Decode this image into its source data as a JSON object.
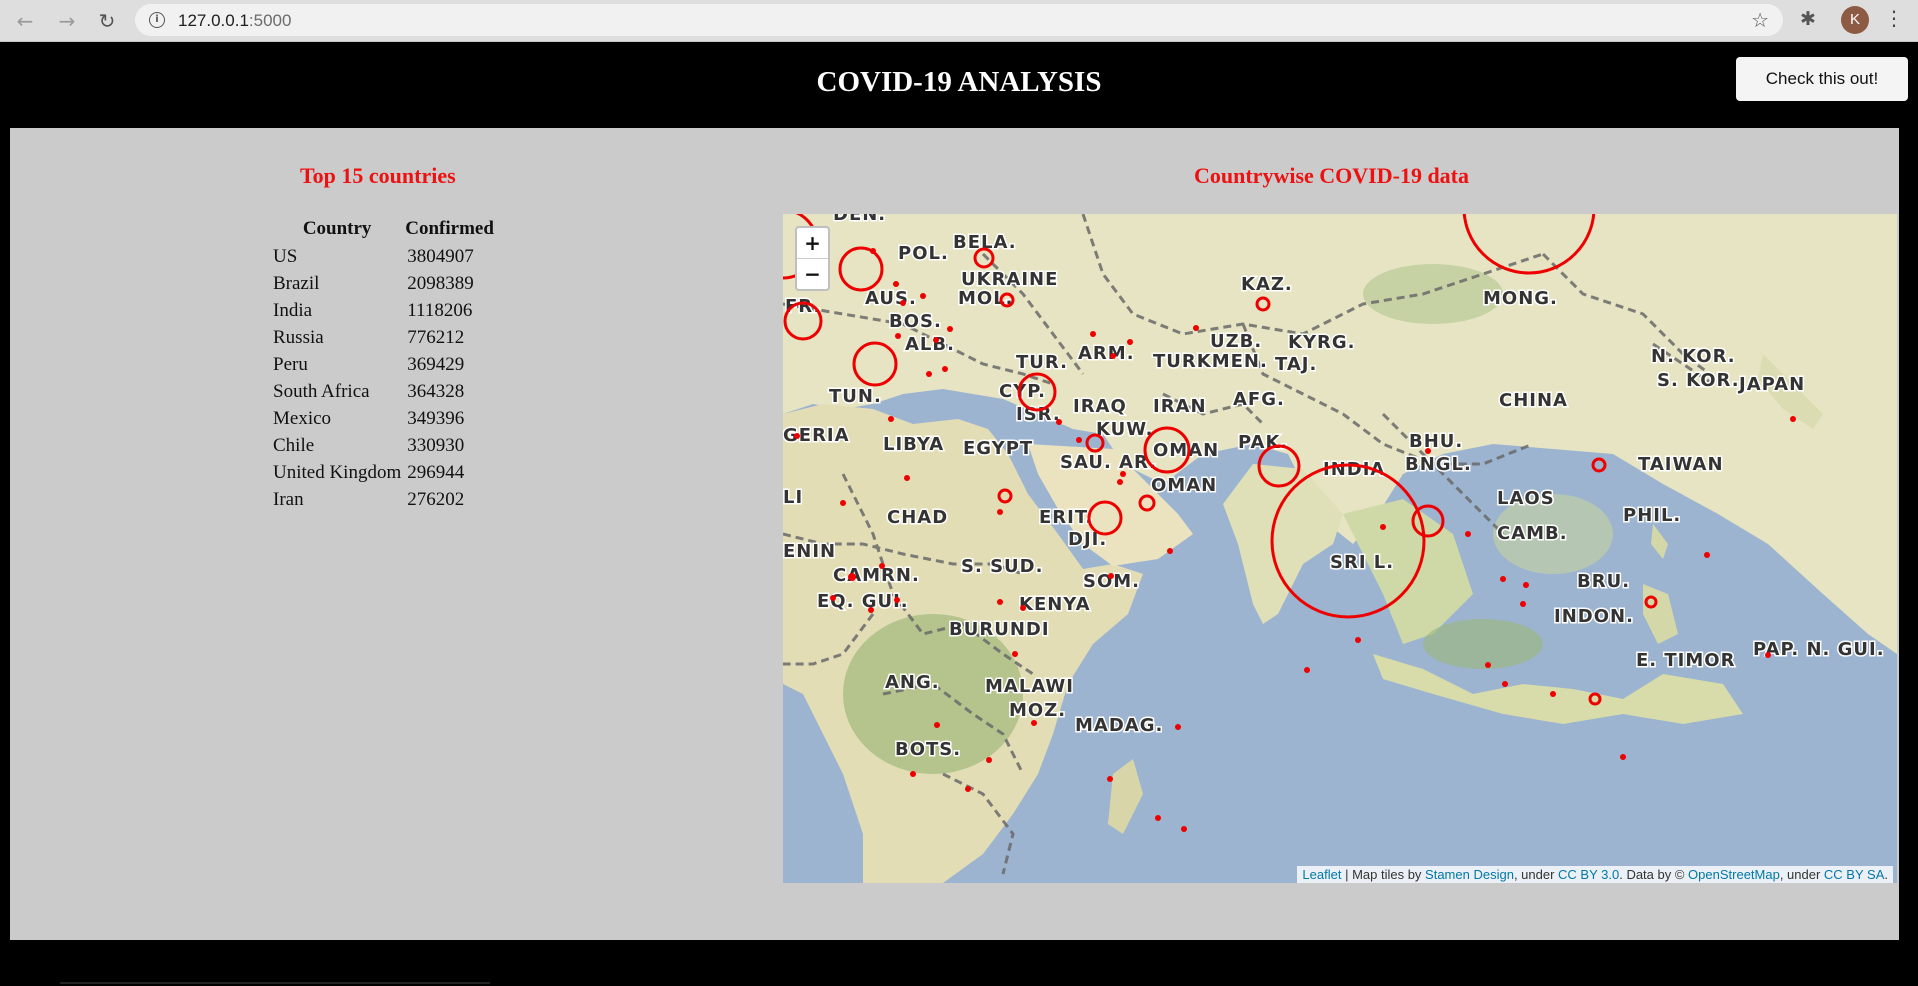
{
  "browser": {
    "url_host": "127.0.0.1",
    "url_port": ":5000",
    "profile_initial": "K"
  },
  "header": {
    "title": "COVID-19 ANALYSIS",
    "check_button": "Check this out!"
  },
  "left": {
    "heading": "Top 15 countries",
    "columns": [
      "Country",
      "Confirmed"
    ],
    "rows": [
      [
        "US",
        "3804907"
      ],
      [
        "Brazil",
        "2098389"
      ],
      [
        "India",
        "1118206"
      ],
      [
        "Russia",
        "776212"
      ],
      [
        "Peru",
        "369429"
      ],
      [
        "South Africa",
        "364328"
      ],
      [
        "Mexico",
        "349396"
      ],
      [
        "Chile",
        "330930"
      ],
      [
        "United Kingdom",
        "296944"
      ],
      [
        "Iran",
        "276202"
      ]
    ]
  },
  "right": {
    "heading": "Countrywise COVID-19 data"
  },
  "map": {
    "zoom_in": "+",
    "zoom_out": "−",
    "attribution": {
      "leaflet": "Leaflet",
      "text1": " | Map tiles by ",
      "stamen": "Stamen Design",
      "text2": ", under ",
      "ccby": "CC BY 3.0",
      "text3": ". Data by © ",
      "osm": "OpenStreetMap",
      "text4": ", under ",
      "ccbysa": "CC BY SA",
      "text5": "."
    },
    "labels": [
      "DEN.",
      "BELA.",
      "POL.",
      "UKRAINE",
      "KAZ.",
      "MONG.",
      "AUS.",
      "MOL.",
      "FR.",
      "BOS.",
      "ALB.",
      "UZB.",
      "KYRG.",
      "TUR.",
      "ARM.",
      "TURKMEN.",
      "TAJ.",
      "N. KOR.",
      "S. KOR.",
      "JAPAN",
      "TUN.",
      "CYP.",
      "IRAQ",
      "IRAN",
      "AFG.",
      "CHINA",
      "ISR.",
      "KUW.",
      "PAK.",
      "GERIA",
      "LIBYA",
      "EGYPT",
      "OMAN",
      "BHU.",
      "SAU. AR.",
      "INDIA",
      "BNGL.",
      "TAIWAN",
      "OMAN",
      "LI",
      "CHAD",
      "ERIT.",
      "LAOS",
      "PHIL.",
      "DJI.",
      "CAMB.",
      "ENIN",
      "CAMRN.",
      "S. SUD.",
      "SRI L.",
      "SOM.",
      "BRU.",
      "EQ. GUI.",
      "KENYA",
      "INDON.",
      "BURUNDI",
      "PAP. N. GUI.",
      "E. TIMOR",
      "ANG.",
      "MALAWI",
      "MOZ.",
      "MADAG.",
      "BOTS."
    ]
  },
  "colors": {
    "marker": "#ee0000",
    "heading": "#ee1111",
    "panel": "#cbcbcb",
    "ocean": "#9cb4cf",
    "land": "#e7e4c3"
  }
}
